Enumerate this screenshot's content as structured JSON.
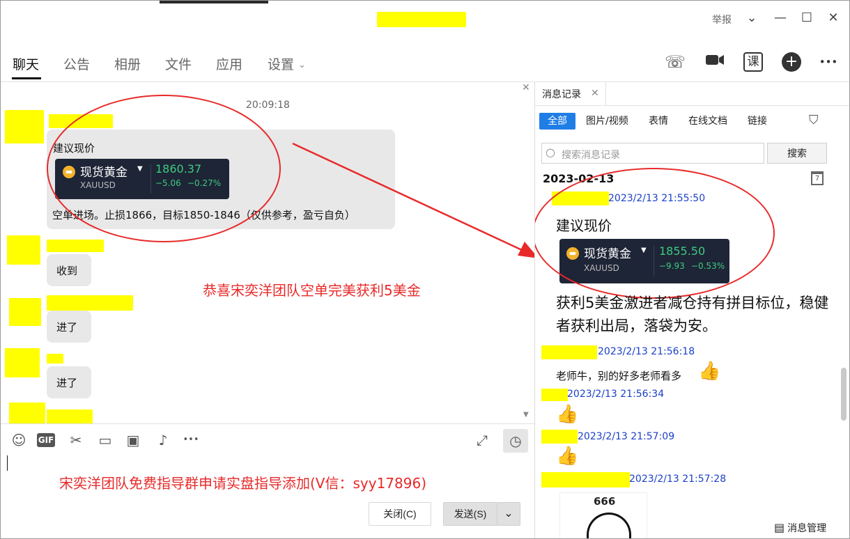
{
  "window": {
    "report_label": "举报",
    "controls": {
      "chevron": "⌄",
      "minimize": "—",
      "maximize": "☐",
      "close": "✕"
    }
  },
  "tabs": [
    {
      "label": "聊天",
      "active": true
    },
    {
      "label": "公告"
    },
    {
      "label": "相册"
    },
    {
      "label": "文件"
    },
    {
      "label": "应用"
    },
    {
      "label": "设置",
      "chevron": "⌄"
    }
  ],
  "toolbar_icons": [
    "phone-icon",
    "video-icon",
    "course-icon",
    "add-icon",
    "more-icon"
  ],
  "toolbar_glyphs": {
    "phone": "☏",
    "video": "▶",
    "course": "课",
    "add": "+",
    "more": "•••"
  },
  "chat": {
    "timestamp": "20:09:18",
    "messages": [
      {
        "title": "建议现价",
        "quote": {
          "name": "现货黄金",
          "code": "XAUUSD",
          "price": "1860.37",
          "change": "−5.06",
          "change_pct": "−0.27%"
        },
        "body": "空单进场。止损1866，目标1850-1846（仅供参考，盈亏自负）"
      },
      {
        "body": "收到"
      },
      {
        "body": "进了"
      },
      {
        "body": "进了"
      }
    ],
    "annotation_congrats": "恭喜宋奕洋团队空单完美获利5美金"
  },
  "input": {
    "toolbar_glyphs": {
      "emoji": "☺",
      "gif": "GIF",
      "scissors": "✂",
      "folder": "▭",
      "image": "▣",
      "bell": "♪",
      "more": "•••",
      "expand": "⤢",
      "history": "◷"
    },
    "annotation_ad": "宋奕洋团队免费指导群申请实盘指导添加(V信：syy17896)",
    "close_label": "关闭(C)",
    "send_label": "发送(S)",
    "send_dropdown": "⌄"
  },
  "history": {
    "tab_label": "消息记录",
    "tab_close": "✕",
    "filters": [
      "全部",
      "图片/视频",
      "表情",
      "在线文档",
      "链接"
    ],
    "filter_icon": "⛉",
    "search_icon": "○",
    "search_placeholder": "搜索消息记录",
    "search_button": "搜索",
    "date": "2023-02-13",
    "calendar_day": "7",
    "entries": [
      {
        "time": "2023/2/13 21:55:50",
        "title": "建议现价",
        "quote": {
          "name": "现货黄金",
          "code": "XAUUSD",
          "price": "1855.50",
          "change": "−9.93",
          "change_pct": "−0.53%"
        },
        "body": "获利5美金激进者减仓持有拼目标位，稳健者获利出局，落袋为安。"
      },
      {
        "time": "2023/2/13 21:56:18",
        "body": "老师牛，别的好多老师看多",
        "emoji": "👍"
      },
      {
        "time": "2023/2/13 21:56:34",
        "emoji": "👍"
      },
      {
        "time": "2023/2/13 21:57:09",
        "emoji": "👍"
      },
      {
        "time": "2023/2/13 21:57:28",
        "preview_number": "666"
      }
    ],
    "footer_glyph": "▤",
    "footer_label": "消息管理"
  },
  "colors": {
    "accent": "#1f7ee6",
    "annotation": "#e82a2a",
    "price_up_green": "#3ecb7e",
    "quote_card_bg": "#1e2537",
    "redaction": "#ffff00",
    "timestamp_blue": "#1a3fc8"
  }
}
